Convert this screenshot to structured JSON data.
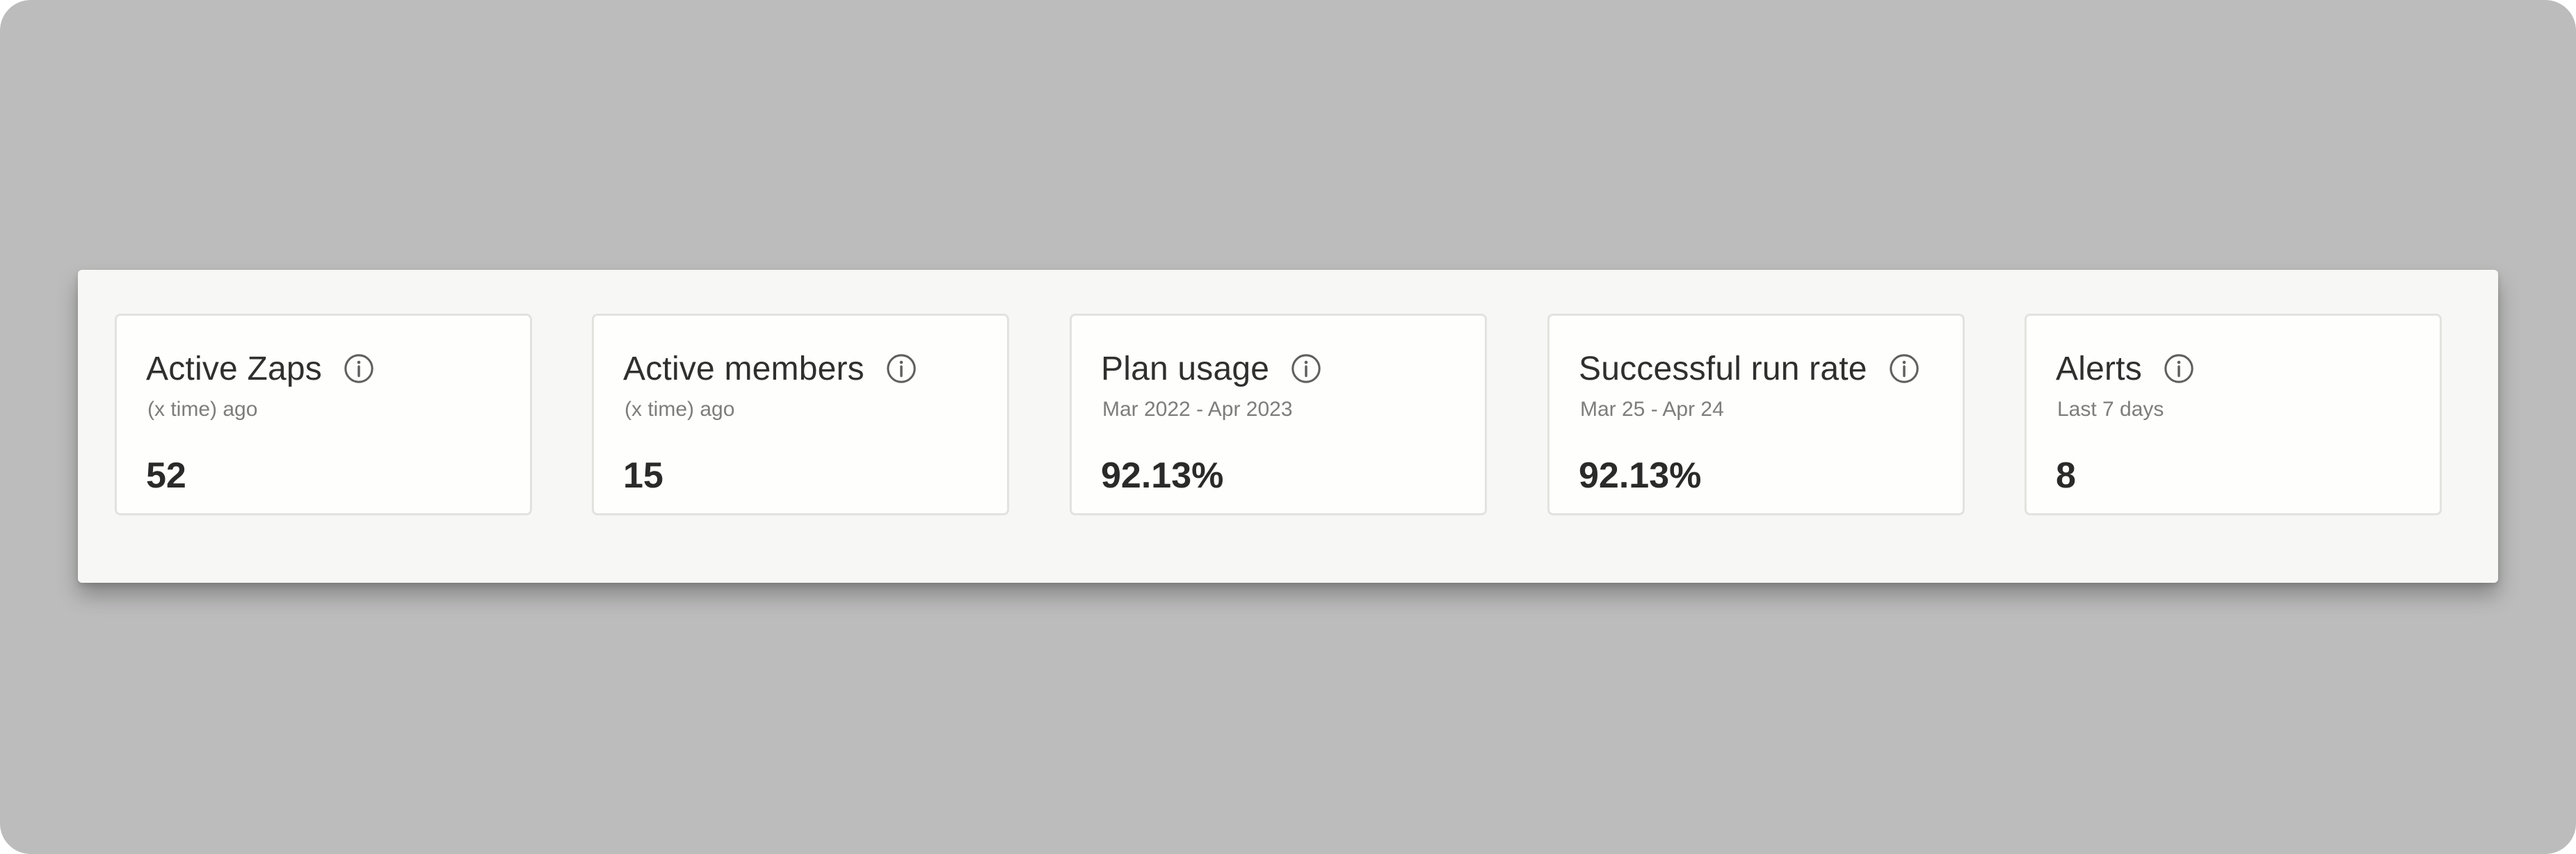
{
  "colors": {
    "backdrop": "#bbbcbb",
    "panel": "#f7f7f5",
    "card": "#fefefc",
    "card_border": "#e2e2df",
    "title_text": "#2f2f2f",
    "subtitle_text": "#7d7d7b",
    "value_text": "#2a2a2a"
  },
  "metrics": [
    {
      "title": "Active Zaps",
      "subtitle": "(x time) ago",
      "value": "52",
      "icon": "info-icon"
    },
    {
      "title": "Active members",
      "subtitle": "(x time) ago",
      "value": "15",
      "icon": "info-icon"
    },
    {
      "title": "Plan usage",
      "subtitle": "Mar 2022 - Apr 2023",
      "value": "92.13%",
      "icon": "info-icon"
    },
    {
      "title": "Successful run rate",
      "subtitle": "Mar 25 - Apr 24",
      "value": "92.13%",
      "icon": "info-icon"
    },
    {
      "title": "Alerts",
      "subtitle": "Last 7 days",
      "value": "8",
      "icon": "info-icon"
    }
  ]
}
